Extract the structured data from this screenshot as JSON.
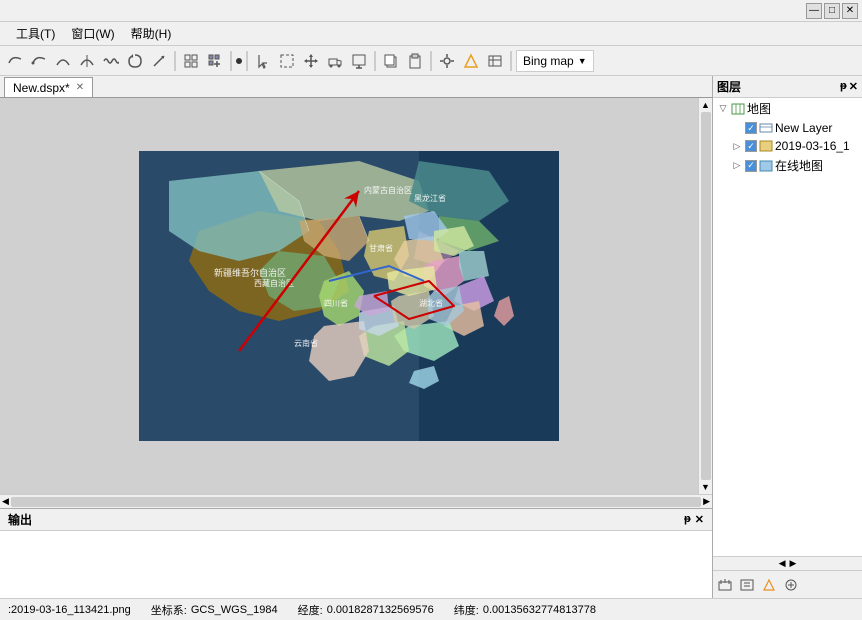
{
  "titlebar": {
    "minimize": "—",
    "maximize": "□",
    "close": "✕"
  },
  "menubar": {
    "items": [
      {
        "id": "tools",
        "label": "工具(T)"
      },
      {
        "id": "window",
        "label": "窗口(W)"
      },
      {
        "id": "help",
        "label": "帮助(H)"
      }
    ]
  },
  "toolbar": {
    "bing_map_label": "Bing map",
    "dropdown_arrow": "▼"
  },
  "tab": {
    "label": "New.dspx*",
    "close": "✕"
  },
  "map_panel": {
    "pin": "ᵽ",
    "close": "✕"
  },
  "layer_panel": {
    "title": "图层",
    "pin": "ᵽ",
    "close": "✕",
    "tree": [
      {
        "id": "ditu",
        "label": "地图",
        "icon": "map-icon",
        "level": 0,
        "expand": "▽",
        "checked": true,
        "children": [
          {
            "id": "new-layer",
            "label": "New Layer",
            "level": 1,
            "expand": "",
            "checked": true
          },
          {
            "id": "date-layer",
            "label": "2019-03-16_1",
            "level": 1,
            "expand": "▷",
            "checked": true
          },
          {
            "id": "online-map",
            "label": "在线地图",
            "level": 1,
            "expand": "▷",
            "checked": true
          }
        ]
      }
    ],
    "bottom_buttons": [
      "←",
      "→",
      "↑",
      "↓",
      "⊞",
      "⊟"
    ]
  },
  "output_panel": {
    "title": "输出",
    "pin": "ᵽ",
    "close": "✕"
  },
  "statusbar": {
    "file": ":2019-03-16_113421.png",
    "coord_sys_label": "坐标系:",
    "coord_sys": "GCS_WGS_1984",
    "lon_label": "经度:",
    "lon": "0.0018287132569576",
    "lat_label": "纬度:",
    "lat": "0.00135632774813778"
  },
  "colors": {
    "accent_red": "#cc0000",
    "accent_blue": "#3366cc",
    "bg": "#f0f0f0",
    "map_bg": "#2a4a6a"
  }
}
